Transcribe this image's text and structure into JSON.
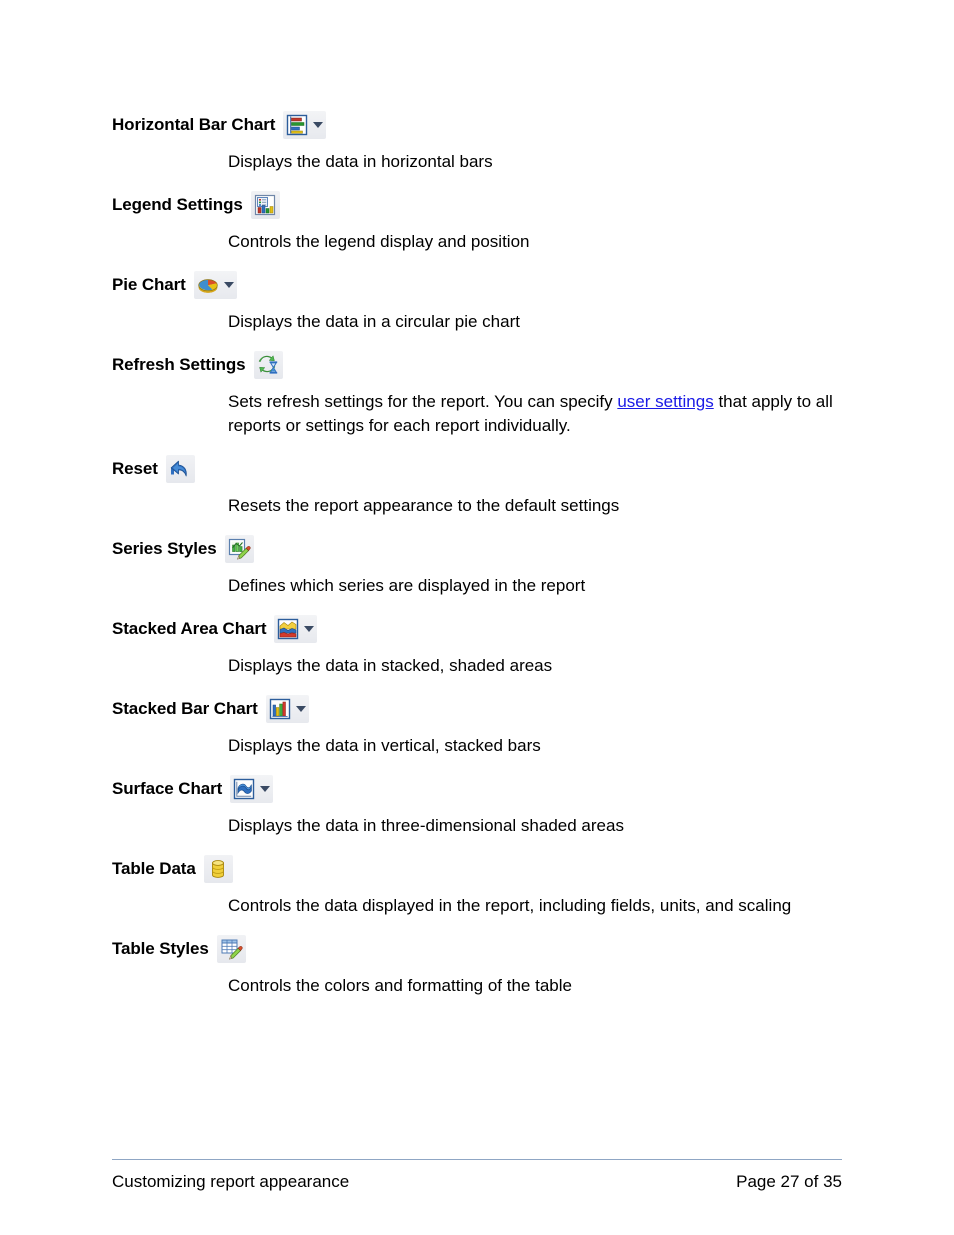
{
  "document": {
    "footer": {
      "left_text": "Customizing report appearance",
      "right_text": "Page 27 of 35",
      "rule_color": "#8fa6c4"
    },
    "link_color": "#1a1ae6"
  },
  "entries": [
    {
      "term": "Horizontal Bar Chart",
      "icon": "horizontal-bar-chart-icon",
      "has_dropdown": true,
      "description": "Displays the data in horizontal bars"
    },
    {
      "term": "Legend Settings",
      "icon": "legend-settings-icon",
      "has_dropdown": false,
      "description": "Controls the legend display and position"
    },
    {
      "term": "Pie Chart",
      "icon": "pie-chart-icon",
      "has_dropdown": true,
      "description": "Displays the data in a circular pie chart"
    },
    {
      "term": "Refresh Settings",
      "icon": "refresh-settings-icon",
      "has_dropdown": false,
      "description_prefix": "Sets refresh settings for the report. You can specify ",
      "description_link": "user settings",
      "description_suffix": " that apply to all reports or settings for each report individually."
    },
    {
      "term": "Reset",
      "icon": "reset-icon",
      "has_dropdown": false,
      "description": "Resets the report appearance to the default settings"
    },
    {
      "term": "Series Styles",
      "icon": "series-styles-icon",
      "has_dropdown": false,
      "description": "Defines which series are displayed in the report"
    },
    {
      "term": "Stacked Area Chart",
      "icon": "stacked-area-chart-icon",
      "has_dropdown": true,
      "description": "Displays the data in stacked, shaded areas"
    },
    {
      "term": "Stacked Bar Chart",
      "icon": "stacked-bar-chart-icon",
      "has_dropdown": true,
      "description": "Displays the data in vertical, stacked bars"
    },
    {
      "term": "Surface Chart",
      "icon": "surface-chart-icon",
      "has_dropdown": true,
      "description": "Displays the data in three-dimensional shaded areas"
    },
    {
      "term": "Table Data",
      "icon": "table-data-icon",
      "has_dropdown": false,
      "description": "Controls the data displayed in the report, including fields, units, and scaling"
    },
    {
      "term": "Table Styles",
      "icon": "table-styles-icon",
      "has_dropdown": false,
      "description": "Controls the colors and formatting of the table"
    }
  ]
}
